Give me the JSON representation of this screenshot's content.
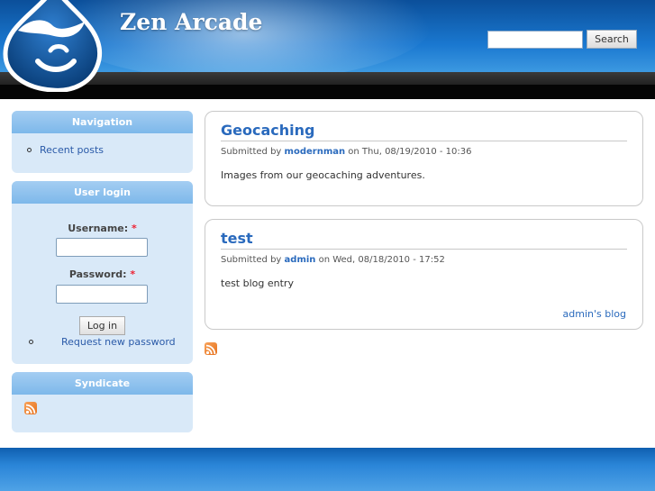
{
  "header": {
    "site_name": "Zen Arcade",
    "search": {
      "value": "",
      "placeholder": "",
      "button_label": "Search"
    }
  },
  "sidebar": {
    "navigation": {
      "title": "Navigation",
      "items": [
        {
          "label": "Recent posts"
        }
      ]
    },
    "user_login": {
      "title": "User login",
      "username_label": "Username:",
      "password_label": "Password:",
      "required_marker": "*",
      "username_value": "",
      "password_value": "",
      "login_button": "Log in",
      "links": [
        {
          "label": "Request new password"
        }
      ]
    },
    "syndicate": {
      "title": "Syndicate",
      "icon": "rss-feed-icon"
    }
  },
  "main": {
    "nodes": [
      {
        "title": "Geocaching",
        "submitted_prefix": "Submitted by",
        "author": "modernman",
        "date_text": "on Thu, 08/19/2010 - 10:36",
        "body": "Images from our geocaching adventures.",
        "link": ""
      },
      {
        "title": "test",
        "submitted_prefix": "Submitted by",
        "author": "admin",
        "date_text": "on Wed, 08/18/2010 - 17:52",
        "body": "test blog entry",
        "link": "admin's blog"
      }
    ],
    "feed_icon": "rss-feed-icon"
  },
  "colors": {
    "accent": "#2a6abd",
    "header_blue": "#1a78d0",
    "block_bg": "#d9e9f8",
    "block_title": "#7db8ea",
    "feed_orange": "#e5701c"
  }
}
